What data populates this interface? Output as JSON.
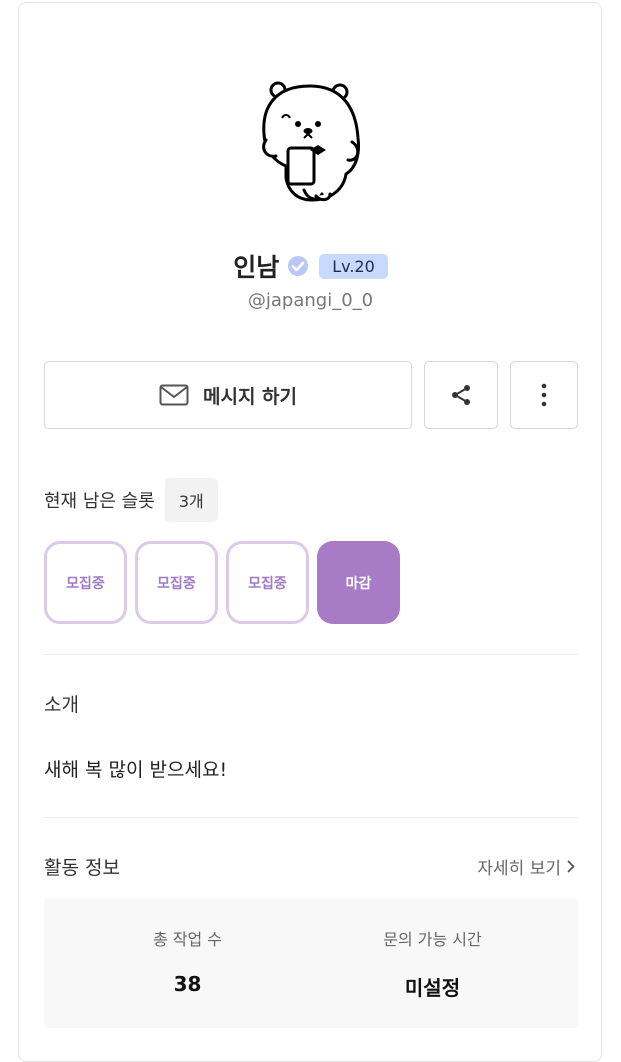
{
  "profile": {
    "name": "인남",
    "level": "Lv.20",
    "handle": "@japangi_0_0"
  },
  "actions": {
    "message_label": "메시지 하기"
  },
  "slots": {
    "label": "현재 남은 슬롯",
    "count": "3개",
    "items": [
      {
        "label": "모집중",
        "status": "open"
      },
      {
        "label": "모집중",
        "status": "open"
      },
      {
        "label": "모집중",
        "status": "open"
      },
      {
        "label": "마감",
        "status": "closed"
      }
    ]
  },
  "intro": {
    "title": "소개",
    "text": "새해 복 많이 받으세요!"
  },
  "activity": {
    "title": "활동 정보",
    "detail_link": "자세히 보기",
    "stats": [
      {
        "label": "총 작업 수",
        "value": "38"
      },
      {
        "label": "문의 가능 시간",
        "value": "미설정"
      }
    ]
  },
  "colors": {
    "accent_purple": "#a97bc6",
    "level_badge_bg": "#c7d9ff",
    "verified_icon": "#b9c8f5"
  },
  "icons": [
    "verified-check-icon",
    "mail-icon",
    "share-icon",
    "more-vertical-icon",
    "chevron-right-icon"
  ]
}
